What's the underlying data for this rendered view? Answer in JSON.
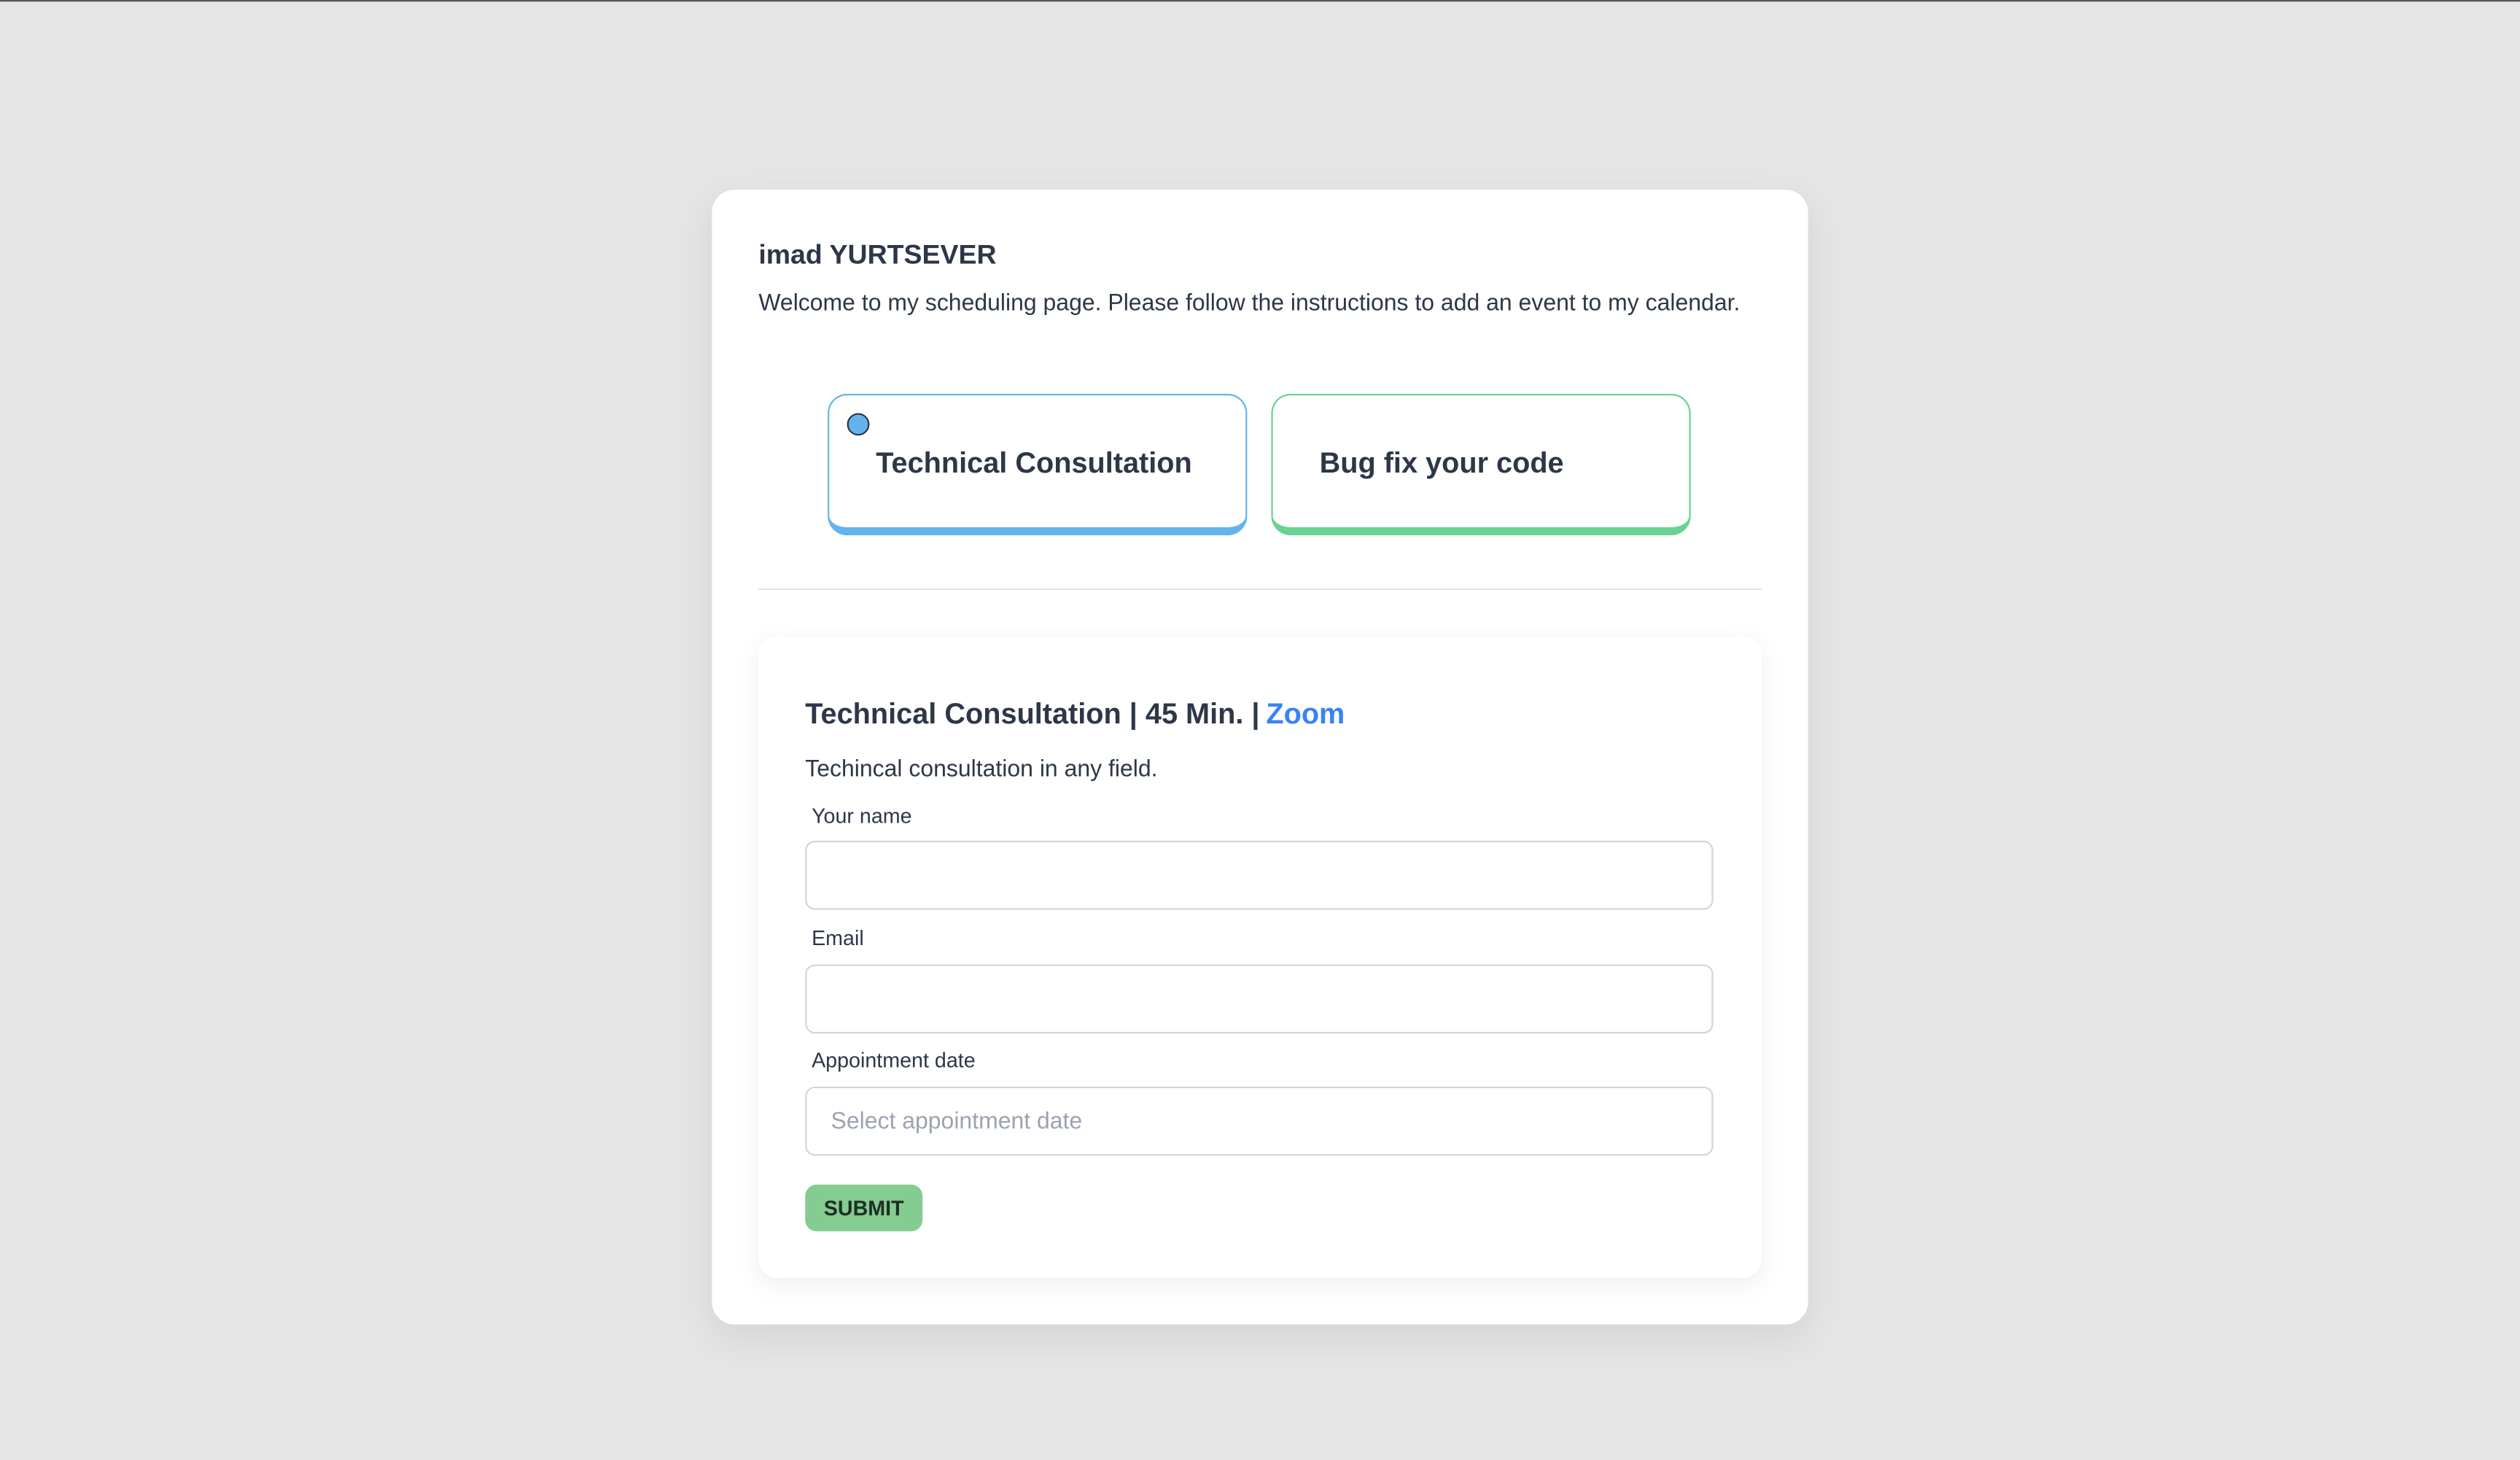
{
  "header": {
    "owner_name": "imad YURTSEVER",
    "welcome_text": "Welcome to my scheduling page. Please follow the instructions to add an event to my calendar."
  },
  "event_types": [
    {
      "label": "Technical Consultation",
      "selected": true,
      "color": "#63b3ed"
    },
    {
      "label": "Bug fix your code",
      "selected": false,
      "color": "#68d391"
    }
  ],
  "form": {
    "event_title": "Technical Consultation | 45 Min. |",
    "location_link": "Zoom",
    "description": "Techincal consultation in any field.",
    "name_label": "Your name",
    "name_value": "",
    "email_label": "Email",
    "email_value": "",
    "date_label": "Appointment date",
    "date_placeholder": "Select appointment date",
    "submit_label": "SUBMIT"
  }
}
